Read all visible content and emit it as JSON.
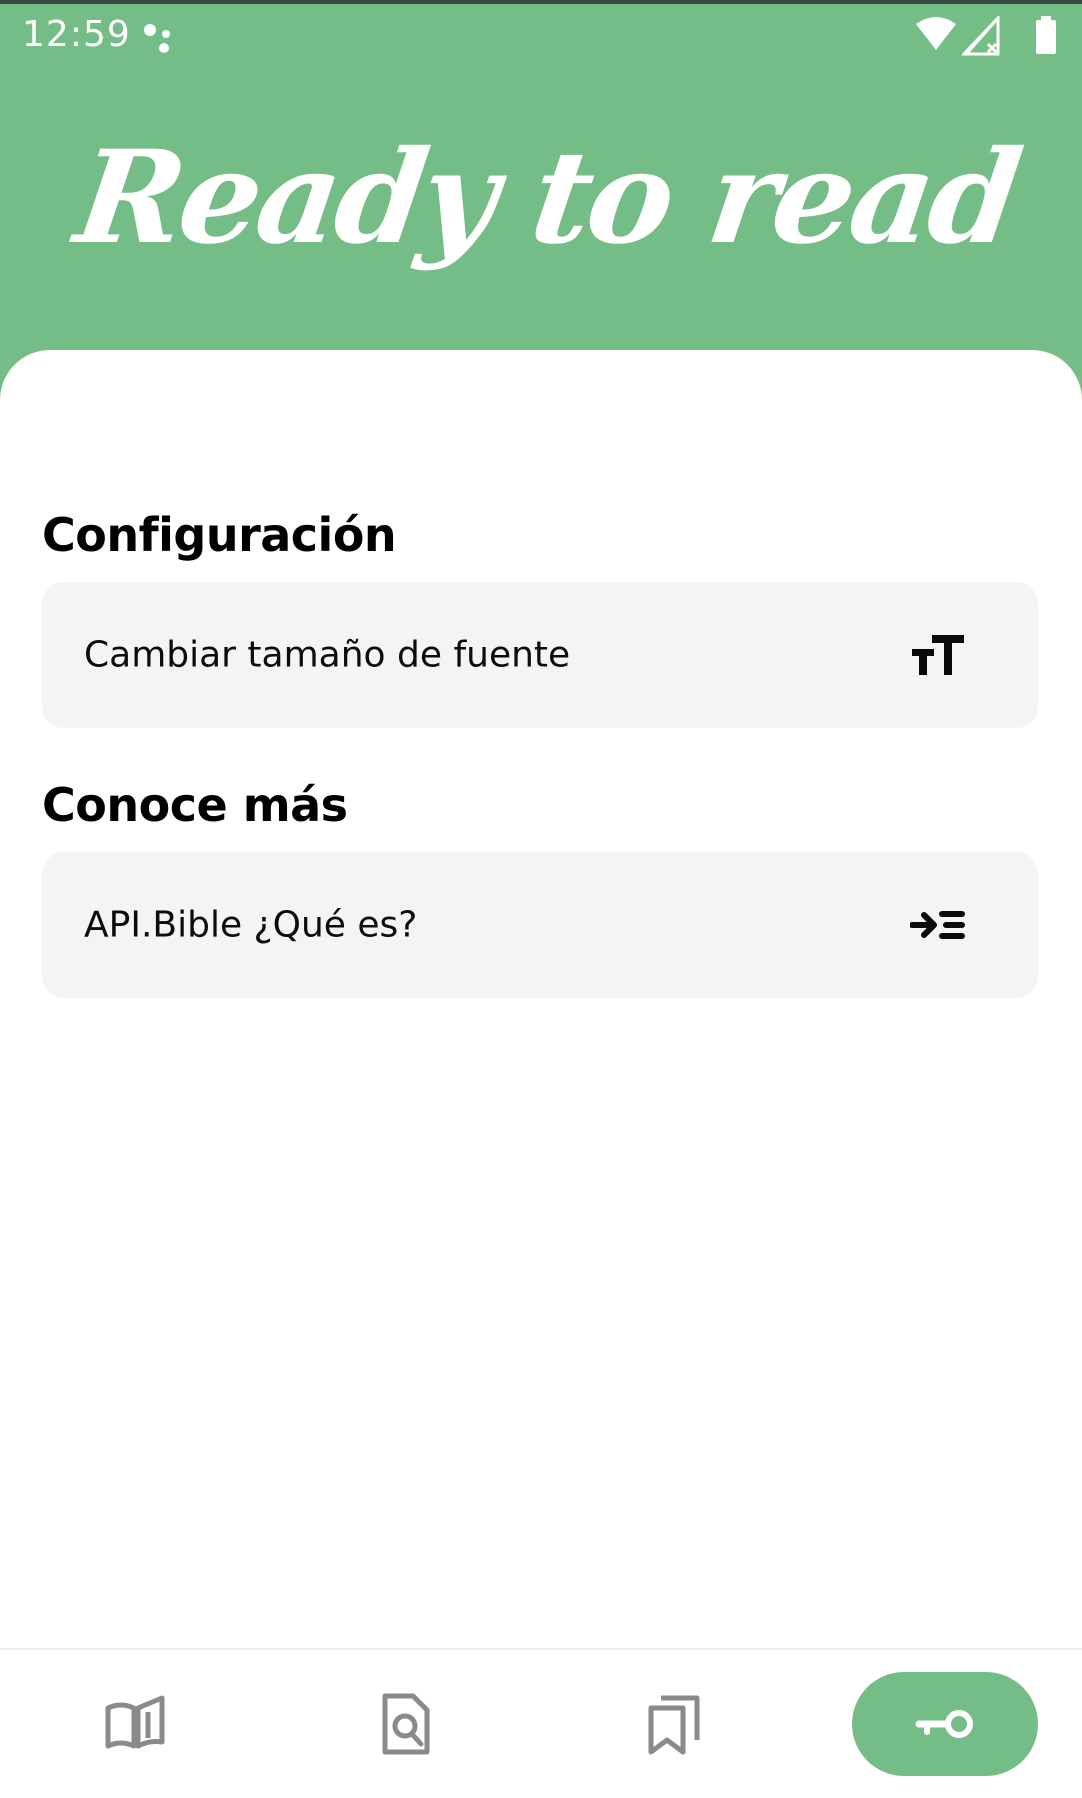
{
  "status_bar": {
    "time": "12:59"
  },
  "header": {
    "title": "Ready to read",
    "background_color": "#75bd87"
  },
  "sections": {
    "settings": {
      "title": "Configuración",
      "item": {
        "label": "Cambiar tamaño de fuente",
        "icon": "text-size-icon"
      }
    },
    "learn_more": {
      "title": "Conoce más",
      "item": {
        "label": "API.Bible ¿Qué es?",
        "icon": "arrow-into-list-icon"
      }
    }
  },
  "bottom_nav": {
    "items": [
      {
        "icon": "open-book-icon",
        "active": false
      },
      {
        "icon": "document-search-icon",
        "active": false
      },
      {
        "icon": "bookmarks-icon",
        "active": false
      },
      {
        "icon": "key-icon",
        "active": true
      }
    ],
    "active_color": "#75bd87",
    "inactive_color": "#8a8a8a"
  }
}
